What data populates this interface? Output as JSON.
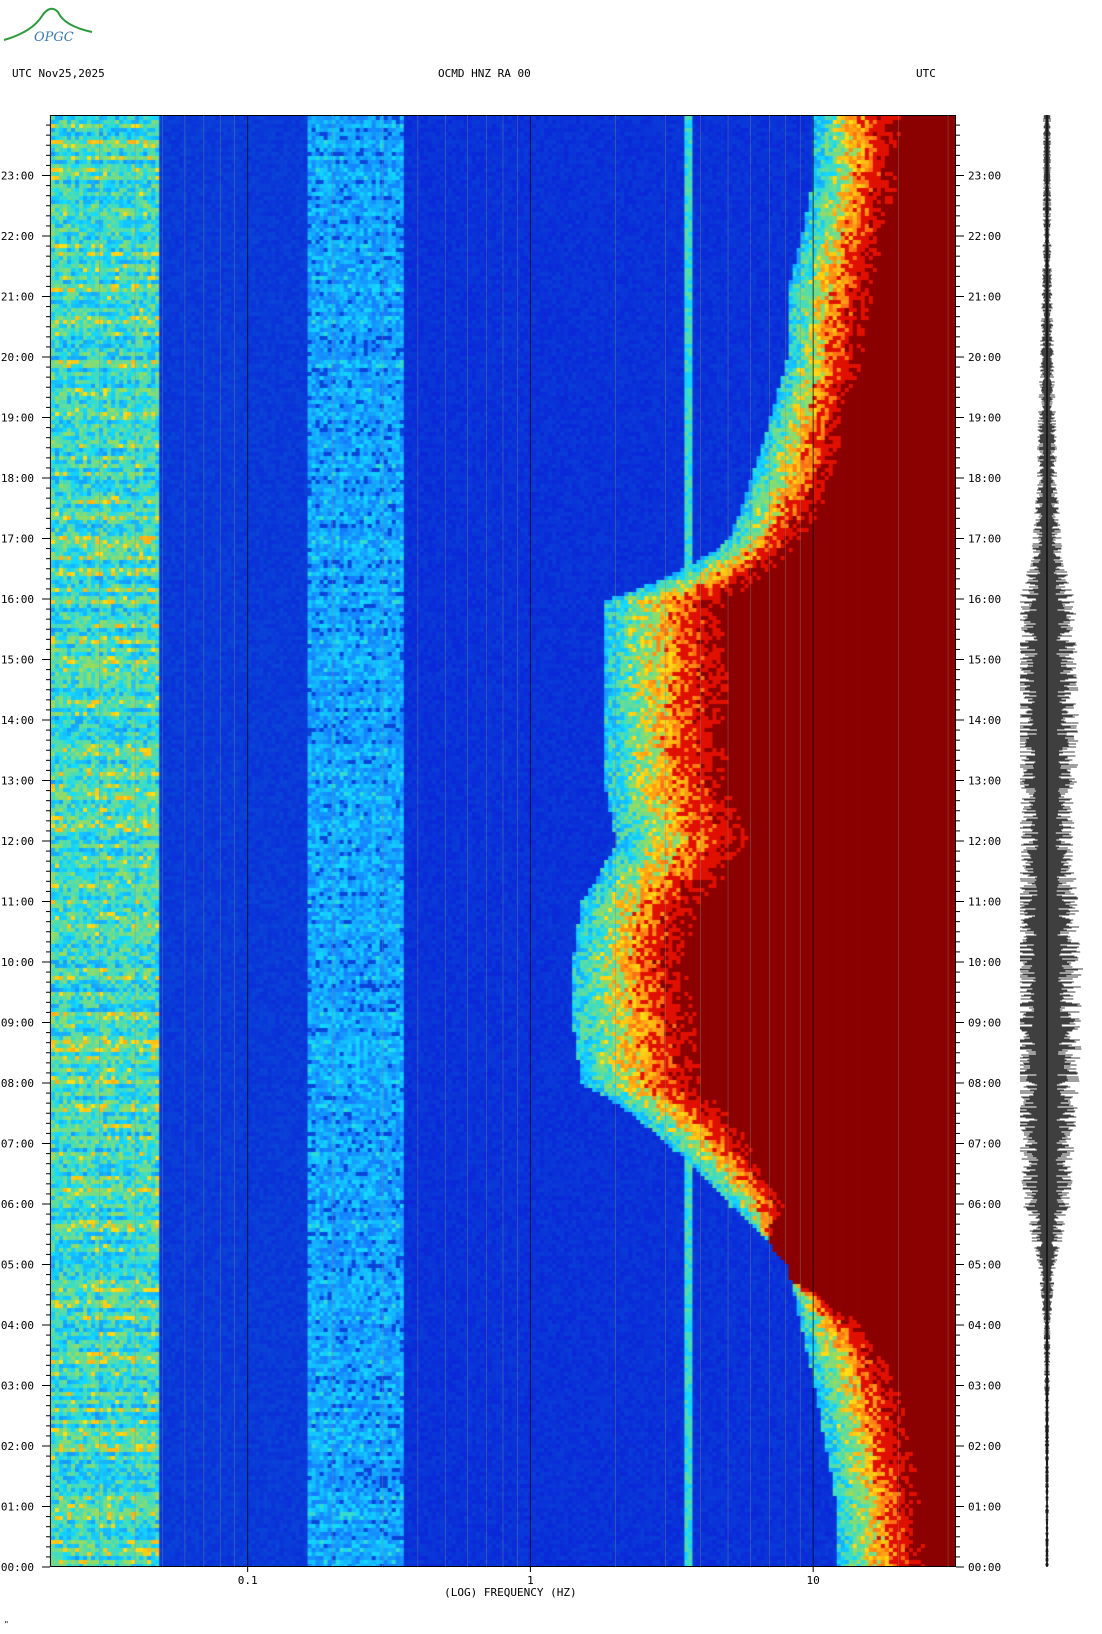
{
  "header": {
    "left": "UTC  Nov25,2025",
    "center": "OCMD HNZ RA 00",
    "right": "UTC"
  },
  "logo": {
    "text": "OPGC"
  },
  "footer_mark": "\"",
  "colors": {
    "background": "#ffffff",
    "low": "#0a18d8",
    "cyan": "#30d8ff",
    "yellow": "#ffe020",
    "red": "#e01000",
    "dark_red": "#8b0000",
    "trace": "#000000"
  },
  "chart_data": {
    "type": "heatmap",
    "title": "OCMD HNZ RA 00",
    "date": "Nov25,2025",
    "timezone": "UTC",
    "xlabel": "(LOG) FREQUENCY (HZ)",
    "xscale": "log",
    "xlim": [
      0.02,
      32
    ],
    "x_ticks": [
      {
        "value": 0.1,
        "label": "0.1"
      },
      {
        "value": 1,
        "label": "1"
      },
      {
        "value": 10,
        "label": "10"
      }
    ],
    "ylim_hours": [
      0,
      24
    ],
    "y_ticks": [
      "00:00",
      "01:00",
      "02:00",
      "03:00",
      "04:00",
      "05:00",
      "06:00",
      "07:00",
      "08:00",
      "09:00",
      "10:00",
      "11:00",
      "12:00",
      "13:00",
      "14:00",
      "15:00",
      "16:00",
      "17:00",
      "18:00",
      "19:00",
      "20:00",
      "21:00",
      "22:00",
      "23:00"
    ],
    "energy_onset_hz_by_hour": [
      12,
      12,
      11,
      10,
      9,
      8,
      5,
      3,
      1.5,
      1.4,
      1.4,
      1.5,
      2,
      1.8,
      1.8,
      1.8,
      1.8,
      5,
      6,
      7,
      8,
      8,
      9,
      10
    ],
    "saturation_onset_hz_by_hour": [
      25,
      24,
      22,
      20,
      15,
      6,
      8,
      6,
      4,
      4,
      3.5,
      4,
      6,
      5,
      5,
      5,
      5,
      9,
      12,
      13,
      15,
      16,
      18,
      20
    ],
    "spectral_lines_hz": [
      3.6
    ],
    "seismogram_amplitude_by_hour": [
      0.05,
      0.05,
      0.06,
      0.08,
      0.1,
      0.25,
      0.7,
      0.8,
      0.9,
      1.0,
      1.0,
      0.9,
      0.75,
      0.85,
      0.9,
      0.85,
      0.8,
      0.4,
      0.3,
      0.25,
      0.2,
      0.15,
      0.12,
      0.12
    ],
    "grid": true
  }
}
